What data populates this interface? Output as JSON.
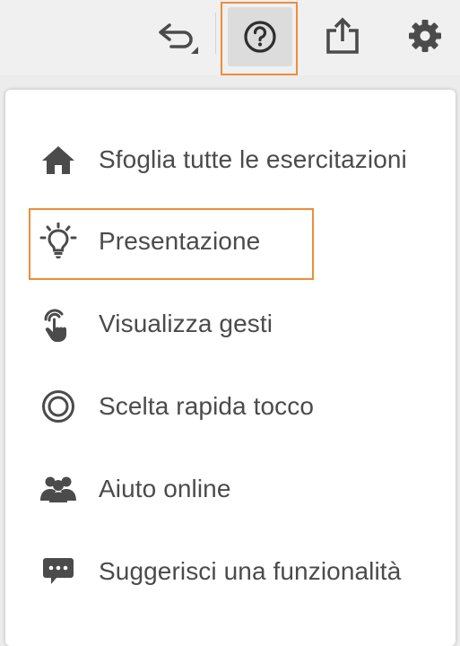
{
  "colors": {
    "highlight": "#ef8c3c",
    "icon": "#4b4b4b",
    "text": "#4b4b4b"
  },
  "toolbar": {
    "icons": [
      "undo-icon",
      "help-icon",
      "share-icon",
      "gear-icon"
    ]
  },
  "menu": {
    "items": [
      {
        "label": "Sfoglia tutte le esercitazioni",
        "icon": "home-icon"
      },
      {
        "label": "Presentazione",
        "icon": "lightbulb-icon"
      },
      {
        "label": "Visualizza gesti",
        "icon": "touch-gesture-icon"
      },
      {
        "label": "Scelta rapida tocco",
        "icon": "touch-shortcut-icon"
      },
      {
        "label": "Aiuto online",
        "icon": "people-icon"
      },
      {
        "label": "Suggerisci una funzionalità",
        "icon": "speech-bubble-icon"
      }
    ]
  }
}
